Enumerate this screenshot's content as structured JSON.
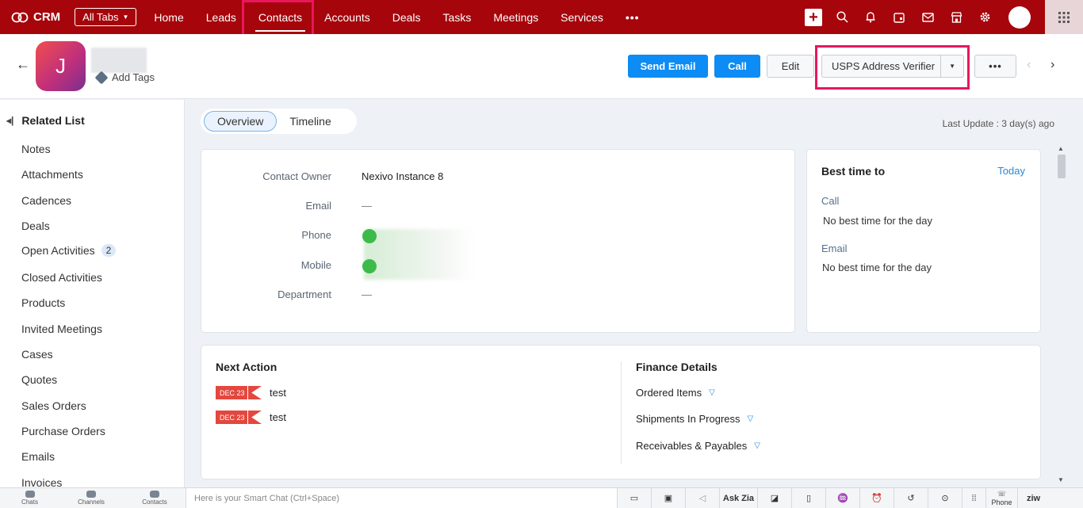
{
  "topbar": {
    "brand": "CRM",
    "all_tabs": "All Tabs",
    "tabs": [
      "Home",
      "Leads",
      "Contacts",
      "Accounts",
      "Deals",
      "Tasks",
      "Meetings",
      "Services"
    ],
    "more": "•••",
    "active_tab": "Contacts"
  },
  "record": {
    "avatar_initial": "J",
    "add_tags": "Add Tags",
    "buttons": {
      "send_email": "Send Email",
      "call": "Call",
      "edit": "Edit",
      "usps": "USPS Address Verifier",
      "more": "•••"
    }
  },
  "sidebar": {
    "heading": "Related List",
    "items": [
      {
        "label": "Notes"
      },
      {
        "label": "Attachments"
      },
      {
        "label": "Cadences"
      },
      {
        "label": "Deals"
      },
      {
        "label": "Open Activities",
        "badge": "2"
      },
      {
        "label": "Closed Activities"
      },
      {
        "label": "Products"
      },
      {
        "label": "Invited Meetings"
      },
      {
        "label": "Cases"
      },
      {
        "label": "Quotes"
      },
      {
        "label": "Sales Orders"
      },
      {
        "label": "Purchase Orders"
      },
      {
        "label": "Emails"
      },
      {
        "label": "Invoices"
      }
    ]
  },
  "main": {
    "tabs": [
      "Overview",
      "Timeline"
    ],
    "last_update": "Last Update : 3 day(s) ago",
    "fields": [
      {
        "label": "Contact Owner",
        "value": "Nexivo Instance 8"
      },
      {
        "label": "Email",
        "value": "—"
      },
      {
        "label": "Phone",
        "value": ""
      },
      {
        "label": "Mobile",
        "value": ""
      },
      {
        "label": "Department",
        "value": "—"
      }
    ],
    "best_time": {
      "title": "Best time to",
      "today": "Today",
      "call_label": "Call",
      "call_value": "No best time for the day",
      "email_label": "Email",
      "email_value": "No best time for the day"
    },
    "next_action": {
      "title": "Next Action",
      "items": [
        {
          "date": "DEC 23",
          "text": "test"
        },
        {
          "date": "DEC 23",
          "text": "test"
        }
      ]
    },
    "finance": {
      "title": "Finance Details",
      "items": [
        "Ordered Items",
        "Shipments In Progress",
        "Receivables & Payables"
      ]
    }
  },
  "bottombar": {
    "items": [
      "Chats",
      "Channels",
      "Contacts"
    ],
    "smart_chat_placeholder": "Here is your Smart Chat (Ctrl+Space)",
    "ask_zia": "Ask Zia",
    "phone": "Phone",
    "zia": "ziw"
  },
  "colors": {
    "topbar": "#a6050b",
    "primary": "#0c8cf4",
    "highlight": "#e8175d"
  }
}
